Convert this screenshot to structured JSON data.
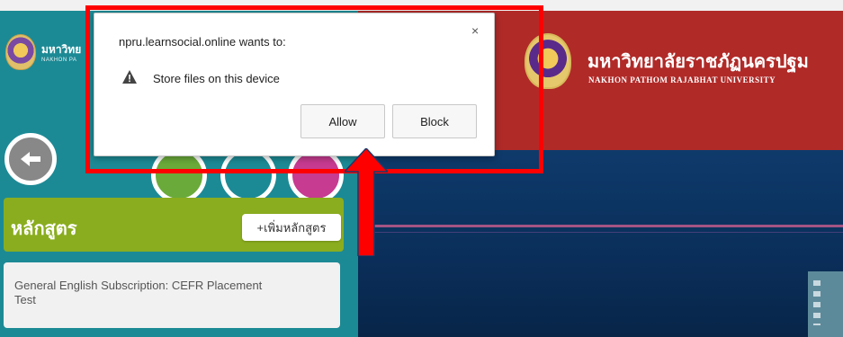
{
  "sidebar": {
    "brand_title": "มหาวิทย",
    "brand_sub": "NAKHON PA",
    "course_section_title": "หลักสูตร",
    "add_course_label": "+เพิ่มหลักสูตร",
    "course_items": [
      "General English Subscription: CEFR Placement Test"
    ]
  },
  "header": {
    "university_name_th": "มหาวิทยาลัยราชภัฏนครปฐม",
    "university_name_en": "NAKHON PATHOM RAJABHAT UNIVERSITY"
  },
  "permission_dialog": {
    "title": "npru.learnsocial.online wants to:",
    "close_symbol": "×",
    "permission_text": "Store files on this device",
    "allow_label": "Allow",
    "block_label": "Block"
  },
  "colors": {
    "sidebar_teal": "#1c8a95",
    "header_maroon": "#b02a28",
    "course_header_green": "#8aad1f",
    "highlight_red": "#ff0000"
  },
  "icons": {
    "back": "arrow-left-icon",
    "warning": "warning-icon",
    "close": "close-icon",
    "annotation": "arrow-up-icon"
  }
}
